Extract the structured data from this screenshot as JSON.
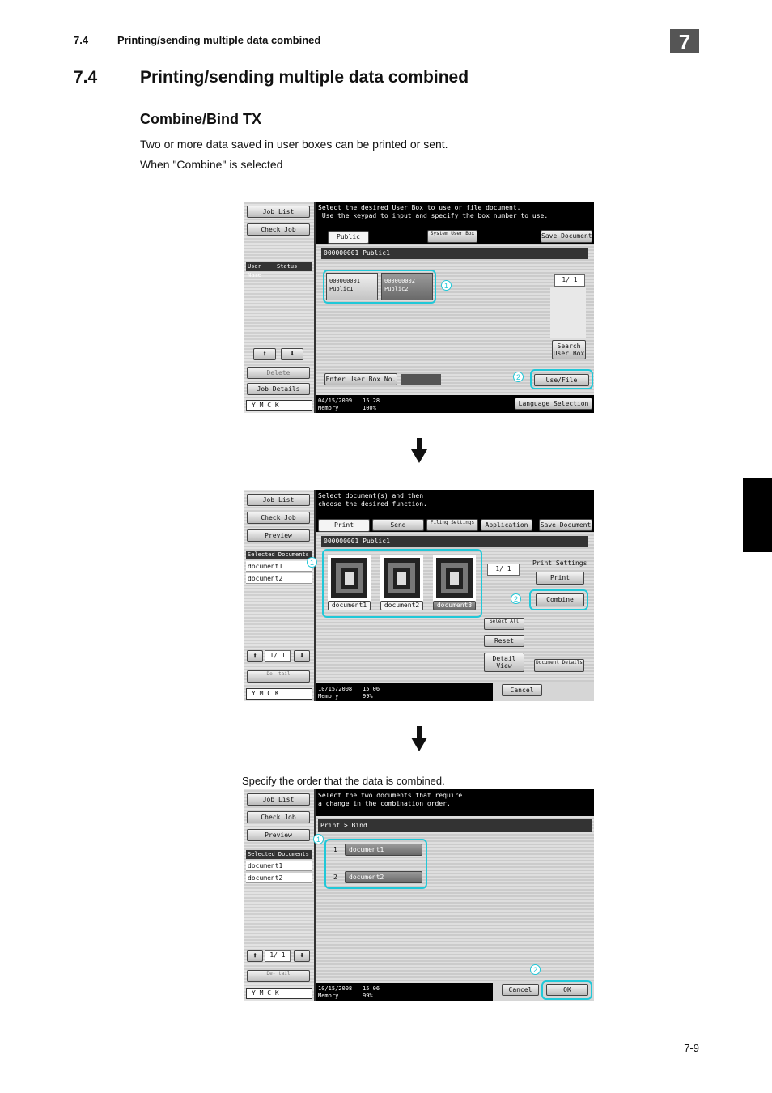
{
  "header": {
    "section": "7.4",
    "title": "Printing/sending multiple data combined",
    "chapter": "7"
  },
  "heading": {
    "number": "7.4",
    "title": "Printing/sending multiple data combined"
  },
  "subheading": "Combine/Bind TX",
  "paragraphs": [
    "Two or more data saved in user boxes can be printed or sent.",
    "When \"Combine\" is selected"
  ],
  "caption": "Specify the order that the data is combined.",
  "footer": {
    "page": "7-9"
  },
  "colors": {
    "highlight": "#21c8d8",
    "chapter_box": "#555555"
  },
  "screen1": {
    "left": {
      "job_list": "Job List",
      "check_job": "Check Job",
      "user_name": "User Name",
      "status": "Status",
      "delete": "Delete",
      "job_details": "Job Details"
    },
    "message": "Select the desired User Box to use or file document.\n Use the keypad to input and specify the box number to use.",
    "tabs": {
      "public": "Public",
      "system": "System User Box",
      "save_document": "Save Document"
    },
    "path": "000000001  Public1",
    "boxes": [
      {
        "number": "000000001",
        "name": "Public1"
      },
      {
        "number": "000000002",
        "name": "Public2"
      }
    ],
    "page": "1/ 1",
    "search": "Search User Box",
    "enter_box_no": "Enter User Box No.",
    "use_file": "Use/File",
    "language": "Language Selection",
    "status": {
      "date": "04/15/2009",
      "time": "15:28",
      "memory": "Memory",
      "pct": "100%"
    },
    "toner": "Y M C K",
    "markers": [
      "1",
      "2"
    ]
  },
  "screen2": {
    "left": {
      "job_list": "Job List",
      "check_job": "Check Job",
      "preview": "Preview",
      "selected_documents": "Selected Documents",
      "items": [
        "document1",
        "document2"
      ],
      "page": "1/ 1",
      "detail": "De- tail"
    },
    "message": "Select document(s) and then\nchoose the desired function.",
    "tabs": {
      "print": "Print",
      "send": "Send",
      "filing": "Filing Settings",
      "application": "Application",
      "save_document": "Save Document"
    },
    "path": "000000001  Public1",
    "documents": [
      "document1",
      "document2",
      "document3"
    ],
    "page": "1/ 1",
    "print_settings": "Print Settings",
    "print": "Print",
    "combine": "Combine",
    "select_all": "Select All",
    "reset": "Reset",
    "detail_view": "Detail View",
    "document_details": "Document Details",
    "cancel": "Cancel",
    "status": {
      "date": "10/15/2008",
      "time": "15:06",
      "memory": "Memory",
      "pct": "99%"
    },
    "toner": "Y M C K",
    "markers": [
      "1",
      "2"
    ]
  },
  "screen3": {
    "left": {
      "job_list": "Job List",
      "check_job": "Check Job",
      "preview": "Preview",
      "selected_documents": "Selected Documents",
      "items": [
        "document1",
        "document2"
      ],
      "page": "1/ 1",
      "detail": "De- tail"
    },
    "message": "Select the two documents that require\na change in the combination order.",
    "breadcrumb": "Print > Bind",
    "order": [
      {
        "index": "1",
        "name": "document1"
      },
      {
        "index": "2",
        "name": "document2"
      }
    ],
    "cancel": "Cancel",
    "ok": "OK",
    "status": {
      "date": "10/15/2008",
      "time": "15:06",
      "memory": "Memory",
      "pct": "99%"
    },
    "toner": "Y M C K",
    "markers": [
      "1",
      "2"
    ]
  }
}
